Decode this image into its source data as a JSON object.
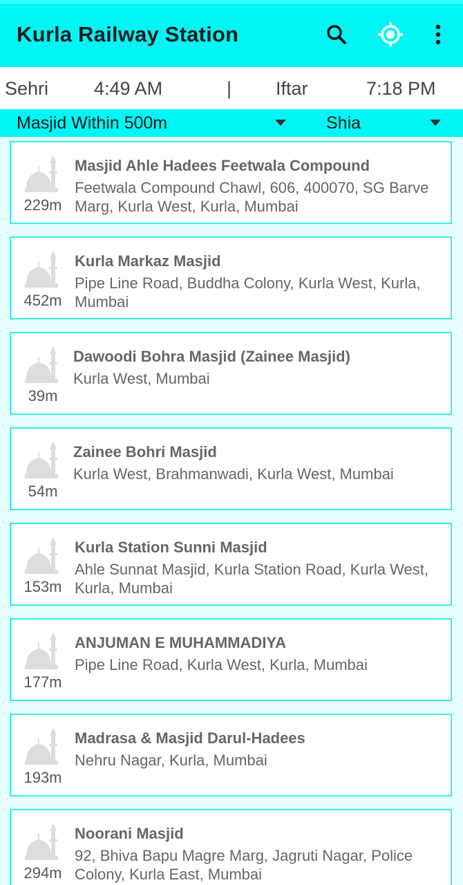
{
  "app_bar": {
    "title": "Kurla Railway Station",
    "search_icon": "search-icon",
    "location_icon": "gps-target-icon",
    "menu_icon": "more-vert-icon"
  },
  "timings": {
    "sehri_label": "Sehri",
    "sehri_time": "4:49 AM",
    "separator": "|",
    "iftar_label": "Iftar",
    "iftar_time": "7:18 PM"
  },
  "filters": {
    "distance_selected": "Masjid Within 500m",
    "sect_selected": "Shia"
  },
  "masjids": [
    {
      "name": "Masjid Ahle Hadees Feetwala Compound",
      "address": "Feetwala Compound Chawl, 606, 400070, SG Barve Marg, Kurla West, Kurla, Mumbai",
      "distance": "229m"
    },
    {
      "name": "Kurla Markaz Masjid",
      "address": "Pipe Line Road, Buddha Colony, Kurla West, Kurla, Mumbai",
      "distance": "452m"
    },
    {
      "name": "Dawoodi Bohra Masjid (Zainee Masjid)",
      "address": "Kurla West, Mumbai",
      "distance": "39m"
    },
    {
      "name": "Zainee Bohri Masjid",
      "address": "Kurla West, Brahmanwadi, Kurla West, Mumbai",
      "distance": "54m"
    },
    {
      "name": "Kurla Station Sunni Masjid",
      "address": "Ahle Sunnat Masjid, Kurla Station Road, Kurla West, Kurla, Mumbai",
      "distance": "153m"
    },
    {
      "name": "ANJUMAN E MUHAMMADIYA",
      "address": "Pipe Line Road, Kurla West, Kurla, Mumbai",
      "distance": "177m"
    },
    {
      "name": "Madrasa & Masjid Darul-Hadees",
      "address": "Nehru Nagar, Kurla, Mumbai",
      "distance": "193m"
    },
    {
      "name": "Noorani Masjid",
      "address": "92, Bhiva Bapu Magre Marg, Jagruti Nagar, Police Colony, Kurla East, Mumbai",
      "distance": "294m"
    }
  ],
  "colors": {
    "accent": "#00f5f5",
    "card_border": "#33f0f0",
    "background": "#e6fdfd"
  }
}
